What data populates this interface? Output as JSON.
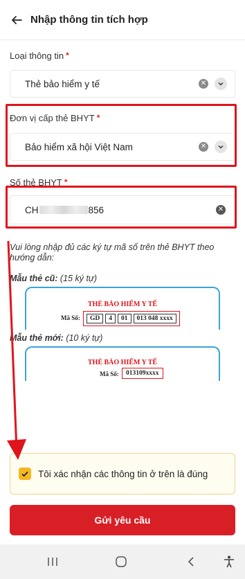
{
  "header": {
    "title": "Nhập thông tin tích hợp",
    "back_icon": "arrow-left-icon"
  },
  "fields": {
    "info_type": {
      "label": "Loại thông tin",
      "required_mark": "*",
      "value": "Thẻ bảo hiểm y tế"
    },
    "issuer": {
      "label": "Đơn vị cấp thẻ BHYT",
      "required_mark": "*",
      "value": "Bảo hiểm xã hội Việt Nam"
    },
    "card_number": {
      "label": "Số thẻ BHYT",
      "required_mark": "*",
      "value_prefix": "CH",
      "value_suffix": "856"
    }
  },
  "hint": "Vui lòng nhập đủ các ký tự mã số trên thẻ BHYT theo hướng dẫn:",
  "samples": {
    "old": {
      "label_bold": "Mẫu thẻ cũ:",
      "label_rest": " (15 ký tự)",
      "card_title": "THẺ BẢO HIỂM Y TẾ",
      "ms_label": "Mã Số:",
      "cells": [
        "GD",
        "4",
        "01",
        "013 048 xxxx"
      ]
    },
    "new": {
      "label_bold": "Mẫu thẻ mới:",
      "label_rest": " (10 ký tự)",
      "card_title": "THẺ BẢO HIỂM Y TẾ",
      "ms_label": "Mã Số:",
      "code": "013109xxxx"
    }
  },
  "confirm": {
    "text": "Tôi xác nhận các thông tin ở trên là đúng",
    "checked": true
  },
  "submit_label": "Gửi yêu cầu",
  "colors": {
    "accent_red": "#d81f26",
    "highlight_red": "#e0141c",
    "checkbox_yellow": "#f6b820",
    "card_border": "#39a4d8"
  }
}
